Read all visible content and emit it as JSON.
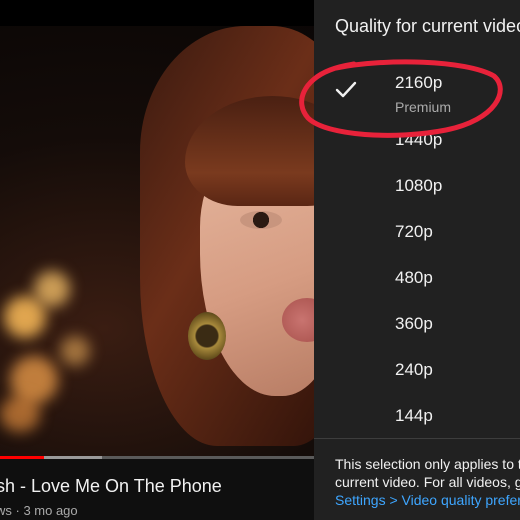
{
  "video": {
    "title": "sh - Love Me On The Phone",
    "meta": "ws · 3 mo ago",
    "progress_played_fraction": 0.085,
    "progress_buffered_fraction": 0.196
  },
  "quality_panel": {
    "header": "Quality for current video",
    "options": [
      {
        "label": "2160p",
        "sub": "Premium",
        "selected": true
      },
      {
        "label": "1440p"
      },
      {
        "label": "1080p"
      },
      {
        "label": "720p"
      },
      {
        "label": "480p"
      },
      {
        "label": "360p"
      },
      {
        "label": "240p"
      },
      {
        "label": "144p"
      }
    ],
    "footer_text": "This selection only applies to the current video. For all videos, go to ",
    "footer_link": "Settings > Video quality preferences."
  },
  "colors": {
    "panel_bg": "#212121",
    "link": "#3ea6ff",
    "progress_played": "#ff0000",
    "annotation_circle": "#e8223a"
  },
  "icons": {
    "selected_indicator": "checkmark-icon"
  }
}
